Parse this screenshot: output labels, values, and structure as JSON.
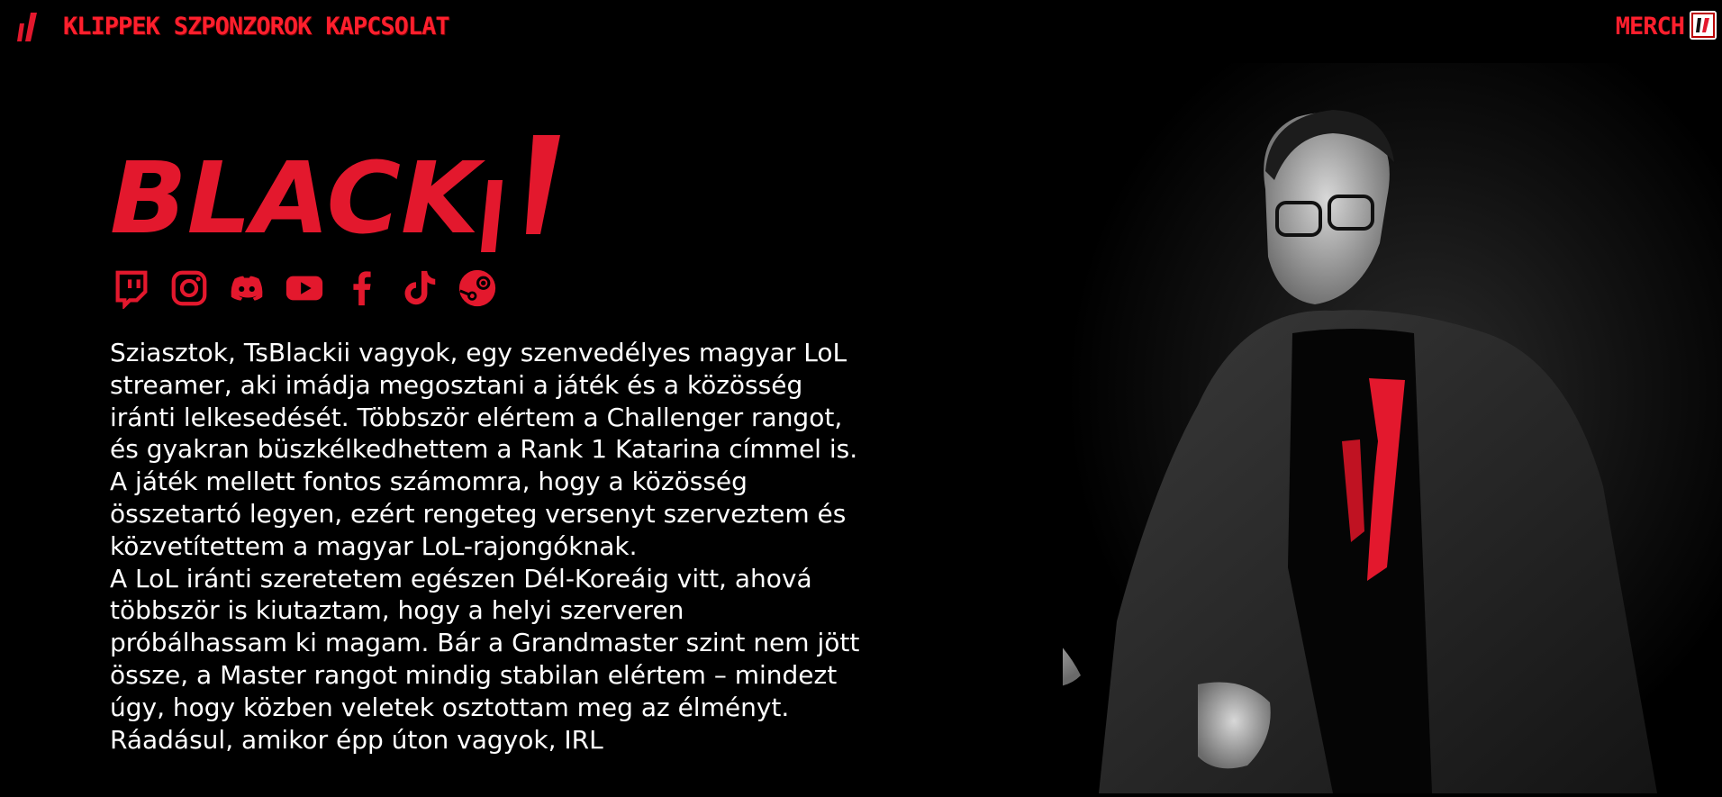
{
  "nav": {
    "logo_icon": "blackii-mark-icon",
    "links": [
      "KLIPPEK",
      "SZPONZOROK",
      "KAPCSOLAT"
    ],
    "merch_label": "MERCH"
  },
  "hero": {
    "logo_text": "BLACK",
    "socials": [
      "twitch-icon",
      "instagram-icon",
      "discord-icon",
      "youtube-icon",
      "facebook-icon",
      "tiktok-icon",
      "steam-icon"
    ],
    "bio_paragraph_1": "Sziasztok, TsBlackii vagyok, egy szenvedélyes magyar LoL streamer, aki imádja megosztani a játék és a közösség iránti lelkesedését. Többször elértem a Challenger rangot, és gyakran büszkélkedhettem a Rank 1 Katarina címmel is. A játék mellett fontos számomra, hogy a közösség összetartó legyen, ezért rengeteg versenyt szerveztem és közvetítettem a magyar LoL-rajongóknak.",
    "bio_paragraph_2": "A LoL iránti szeretetem egészen Dél-Koreáig vitt, ahová többször is kiutaztam, hogy a helyi szerveren próbálhassam ki magam. Bár a Grandmaster szint nem jött össze, a Master rangot mindig stabilan elértem – mindezt úgy, hogy közben veletek osztottam meg az élményt. Ráadásul, amikor épp úton vagyok, IRL"
  },
  "colors": {
    "accent": "#e3182d",
    "nav_red": "#ff1f2d",
    "background": "#000000",
    "text": "#ffffff"
  }
}
